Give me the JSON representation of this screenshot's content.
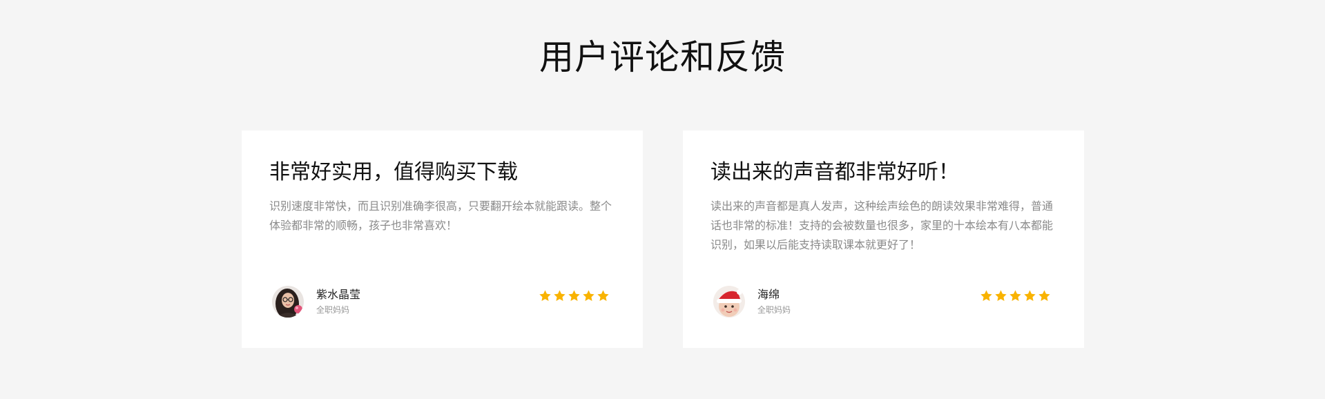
{
  "section": {
    "title": "用户评论和反馈"
  },
  "reviews": [
    {
      "title": "非常好实用，值得购买下载",
      "body": "识别速度非常快，而且识别准确李很高，只要翻开绘本就能跟读。整个体验都非常的顺畅，孩子也非常喜欢！",
      "user_name": "紫水晶莹",
      "user_role": "全职妈妈",
      "avatar_icon": "woman-avatar-icon",
      "rating": 5
    },
    {
      "title": "读出来的声音都非常好听！",
      "body": "读出来的声音都是真人发声，这种绘声绘色的朗读效果非常难得，普通话也非常的标准！支持的会被数量也很多，家里的十本绘本有八本都能识别，如果以后能支持读取课本就更好了！",
      "user_name": "海绵",
      "user_role": "全职妈妈",
      "avatar_icon": "baby-santa-hat-avatar-icon",
      "rating": 5
    }
  ],
  "colors": {
    "page_background": "#f5f5f5",
    "card_background": "#ffffff",
    "star": "#f9b300",
    "body_text": "#8a8a8a"
  }
}
